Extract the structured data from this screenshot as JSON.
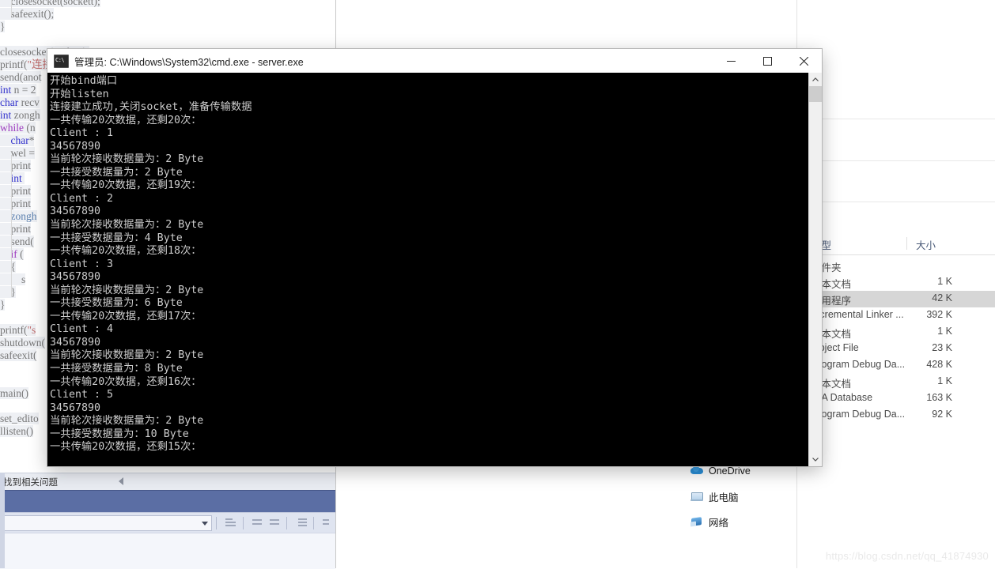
{
  "ide": {
    "code_lines": [
      {
        "indent": 2,
        "parts": [
          {
            "t": "closesocket(sockett);",
            "c": "plain"
          }
        ]
      },
      {
        "indent": 2,
        "parts": [
          {
            "t": "safeexit();",
            "c": "plain"
          }
        ]
      },
      {
        "indent": 0,
        "parts": [
          {
            "t": "}",
            "c": "plain"
          }
        ]
      },
      {
        "indent": 0,
        "parts": [
          {
            "t": "",
            "c": "plain"
          }
        ]
      },
      {
        "indent": 0,
        "parts": [
          {
            "t": "closesocket(sockett);",
            "c": "plain"
          }
        ]
      },
      {
        "indent": 0,
        "parts": [
          {
            "t": "printf(",
            "c": "plain"
          },
          {
            "t": "\"连接建立成功,关闭socket，准备传输数据\\n\"",
            "c": "str"
          },
          {
            "t": ");",
            "c": "plain"
          }
        ]
      },
      {
        "indent": 0,
        "parts": [
          {
            "t": "send(anot",
            "c": "plain"
          }
        ]
      },
      {
        "indent": 0,
        "parts": [
          {
            "t": "int",
            "c": "kw"
          },
          {
            "t": " n = 2",
            "c": "plain"
          }
        ]
      },
      {
        "indent": 0,
        "parts": [
          {
            "t": "char",
            "c": "kw"
          },
          {
            "t": " recv",
            "c": "plain"
          }
        ]
      },
      {
        "indent": 0,
        "parts": [
          {
            "t": "int",
            "c": "kw"
          },
          {
            "t": " zongh",
            "c": "plain"
          }
        ]
      },
      {
        "indent": 0,
        "parts": [
          {
            "t": "while",
            "c": "kwp"
          },
          {
            "t": " (n",
            "c": "plain"
          }
        ]
      },
      {
        "indent": 2,
        "parts": [
          {
            "t": "char",
            "c": "kw"
          },
          {
            "t": "*",
            "c": "plain"
          }
        ]
      },
      {
        "indent": 2,
        "parts": [
          {
            "t": "wel =",
            "c": "plain"
          }
        ]
      },
      {
        "indent": 2,
        "parts": [
          {
            "t": "print",
            "c": "plain"
          }
        ]
      },
      {
        "indent": 2,
        "parts": [
          {
            "t": "int",
            "c": "kw"
          },
          {
            "t": " ",
            "c": "plain"
          }
        ]
      },
      {
        "indent": 2,
        "parts": [
          {
            "t": "print",
            "c": "plain"
          }
        ]
      },
      {
        "indent": 2,
        "parts": [
          {
            "t": "print",
            "c": "plain"
          }
        ]
      },
      {
        "indent": 2,
        "parts": [
          {
            "t": "zongh",
            "c": "id"
          }
        ]
      },
      {
        "indent": 2,
        "parts": [
          {
            "t": "print",
            "c": "plain"
          }
        ]
      },
      {
        "indent": 2,
        "parts": [
          {
            "t": "send(",
            "c": "plain"
          }
        ]
      },
      {
        "indent": 2,
        "parts": [
          {
            "t": "if",
            "c": "kwp"
          },
          {
            "t": " (",
            "c": "plain"
          }
        ]
      },
      {
        "indent": 2,
        "parts": [
          {
            "t": "{",
            "c": "plain"
          }
        ]
      },
      {
        "indent": 4,
        "parts": [
          {
            "t": "s",
            "c": "plain"
          }
        ]
      },
      {
        "indent": 2,
        "parts": [
          {
            "t": "}",
            "c": "plain"
          }
        ]
      },
      {
        "indent": 0,
        "parts": [
          {
            "t": "}",
            "c": "plain"
          }
        ]
      },
      {
        "indent": 0,
        "parts": [
          {
            "t": "",
            "c": "plain"
          }
        ]
      },
      {
        "indent": 0,
        "parts": [
          {
            "t": "printf(",
            "c": "plain"
          },
          {
            "t": "\"s",
            "c": "str"
          }
        ]
      },
      {
        "indent": 0,
        "parts": [
          {
            "t": "shutdown(",
            "c": "plain"
          }
        ]
      },
      {
        "indent": 0,
        "parts": [
          {
            "t": "safeexit(",
            "c": "plain"
          }
        ]
      },
      {
        "indent": 0,
        "parts": [
          {
            "t": "",
            "c": "plain"
          }
        ]
      },
      {
        "indent": 0,
        "parts": [
          {
            "t": "",
            "c": "plain"
          }
        ]
      },
      {
        "indent": 0,
        "parts": [
          {
            "t": "main()",
            "c": "plain"
          }
        ]
      },
      {
        "indent": 0,
        "parts": [
          {
            "t": "",
            "c": "plain"
          }
        ]
      },
      {
        "indent": 0,
        "parts": [
          {
            "t": "set_edito",
            "c": "plain"
          }
        ]
      },
      {
        "indent": 0,
        "parts": [
          {
            "t": "llisten()",
            "c": "plain"
          }
        ]
      }
    ],
    "error_list_label": "找到相关问题",
    "toolbar": {
      "combo_value": "",
      "icons": [
        "indent-icon",
        "outdent-left-icon",
        "outdent-right-icon",
        "comment-icon",
        "uncomment-icon"
      ]
    }
  },
  "explorer": {
    "nav_items": [
      {
        "label": "OneDrive",
        "icon": "onedrive-icon"
      },
      {
        "label": "此电脑",
        "icon": "this-pc-icon"
      },
      {
        "label": "网络",
        "icon": "network-icon"
      }
    ],
    "columns": [
      {
        "label": "类型"
      },
      {
        "label": "大小"
      }
    ],
    "rows": [
      {
        "type": "文件夹",
        "size": "",
        "selected": false
      },
      {
        "type": "文本文档",
        "size": "1 K",
        "selected": false
      },
      {
        "type": "应用程序",
        "size": "42 K",
        "selected": true
      },
      {
        "type": "Incremental Linker ...",
        "size": "392 K",
        "selected": false
      },
      {
        "type": "文本文档",
        "size": "1 K",
        "selected": false
      },
      {
        "type": "Object File",
        "size": "23 K",
        "selected": false
      },
      {
        "type": "Program Debug Da...",
        "size": "428 K",
        "selected": false
      },
      {
        "type": "文本文档",
        "size": "1 K",
        "selected": false
      },
      {
        "type": "IDA Database",
        "size": "163 K",
        "selected": false
      },
      {
        "type": "Program Debug Da...",
        "size": "92 K",
        "selected": false
      }
    ]
  },
  "console": {
    "title": "管理员: C:\\Windows\\System32\\cmd.exe - server.exe",
    "icon": "cmd-icon",
    "window_buttons": {
      "minimize": "minimize-icon",
      "maximize": "maximize-icon",
      "close": "close-icon"
    },
    "output": "开始bind端口\n开始listen\n连接建立成功,关闭socket，准备传输数据\n一共传输20次数据，还剩20次：\nClient : 1\n34567890\n当前轮次接收数据量为：2 Byte\n一共接受数据量为：2 Byte\n一共传输20次数据，还剩19次：\nClient : 2\n34567890\n当前轮次接收数据量为：2 Byte\n一共接受数据量为：4 Byte\n一共传输20次数据，还剩18次：\nClient : 3\n34567890\n当前轮次接收数据量为：2 Byte\n一共接受数据量为：6 Byte\n一共传输20次数据，还剩17次：\nClient : 4\n34567890\n当前轮次接收数据量为：2 Byte\n一共接受数据量为：8 Byte\n一共传输20次数据，还剩16次：\nClient : 5\n34567890\n当前轮次接收数据量为：2 Byte\n一共接受数据量为：10 Byte\n一共传输20次数据，还剩15次：",
    "scrollbar": {
      "up": "scroll-up-icon",
      "down": "scroll-down-icon"
    }
  },
  "watermark": "https://blog.csdn.net/qq_41874930"
}
